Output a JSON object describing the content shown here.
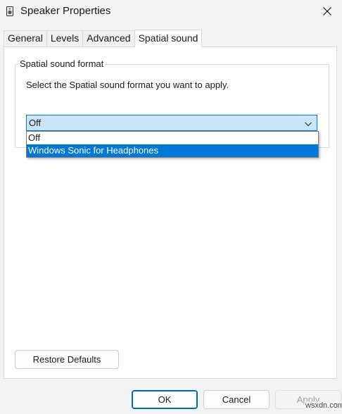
{
  "window": {
    "title": "Speaker Properties",
    "icon": "speaker-icon",
    "close_icon": "close-icon"
  },
  "tabs": [
    {
      "label": "General",
      "active": false
    },
    {
      "label": "Levels",
      "active": false
    },
    {
      "label": "Advanced",
      "active": false
    },
    {
      "label": "Spatial sound",
      "active": true
    }
  ],
  "spatial": {
    "group_label": "Spatial sound format",
    "instruction": "Select the Spatial sound format you want to apply.",
    "selected": "Off",
    "options": [
      "Off",
      "Windows Sonic for Headphones"
    ],
    "highlighted_option": "Windows Sonic for Headphones"
  },
  "buttons": {
    "restore_defaults": "Restore Defaults",
    "ok": "OK",
    "cancel": "Cancel",
    "apply": "Apply",
    "apply_enabled": false
  },
  "watermark": "wsxdn.com",
  "colors": {
    "accent": "#0078d7",
    "combo_highlight": "#cce4f7",
    "window_bg": "#f3f3f3"
  }
}
